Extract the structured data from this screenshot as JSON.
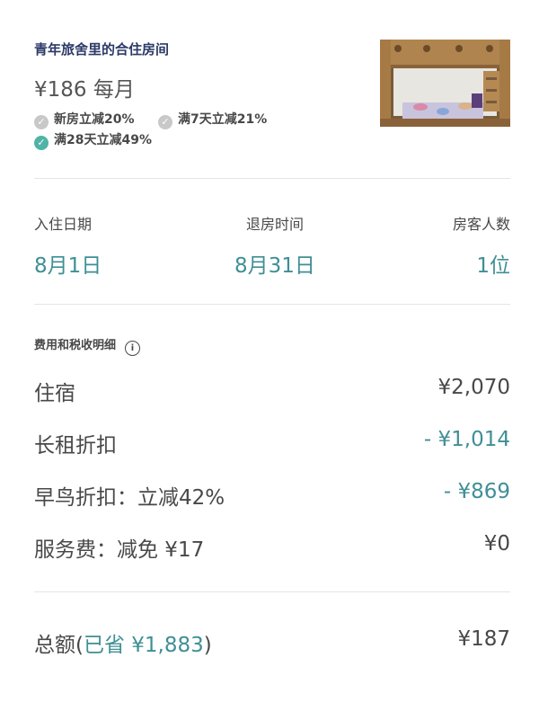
{
  "listing": {
    "title": "青年旅舍里的合住房间",
    "price": "¥186 每月",
    "discounts": [
      {
        "label": "新房立减20%",
        "active": false
      },
      {
        "label": "满7天立减21%",
        "active": false
      },
      {
        "label": "满28天立减49%",
        "active": true
      }
    ]
  },
  "stay": {
    "checkin_label": "入住日期",
    "checkin_value": "8月1日",
    "checkout_label": "退房时间",
    "checkout_value": "8月31日",
    "guests_label": "房客人数",
    "guests_value": "1位"
  },
  "breakdown": {
    "heading": "费用和税收明细",
    "rows": [
      {
        "label": "住宿",
        "amount": "¥2,070",
        "accent": false
      },
      {
        "label": "长租折扣",
        "amount": "- ¥1,014",
        "accent": true
      },
      {
        "label": "早鸟折扣：立减42%",
        "amount": "- ¥869",
        "accent": true
      },
      {
        "label": "服务费：减免 ¥17",
        "amount": "¥0",
        "accent": false
      }
    ]
  },
  "total": {
    "label": "总额(",
    "saved": "已省 ¥1,883",
    "close": ")",
    "amount": "¥187"
  },
  "colors": {
    "accent": "#3f8f95",
    "title": "#2b3a67",
    "check_active": "#4fb3a5",
    "check_inactive": "#c8c8c8"
  }
}
